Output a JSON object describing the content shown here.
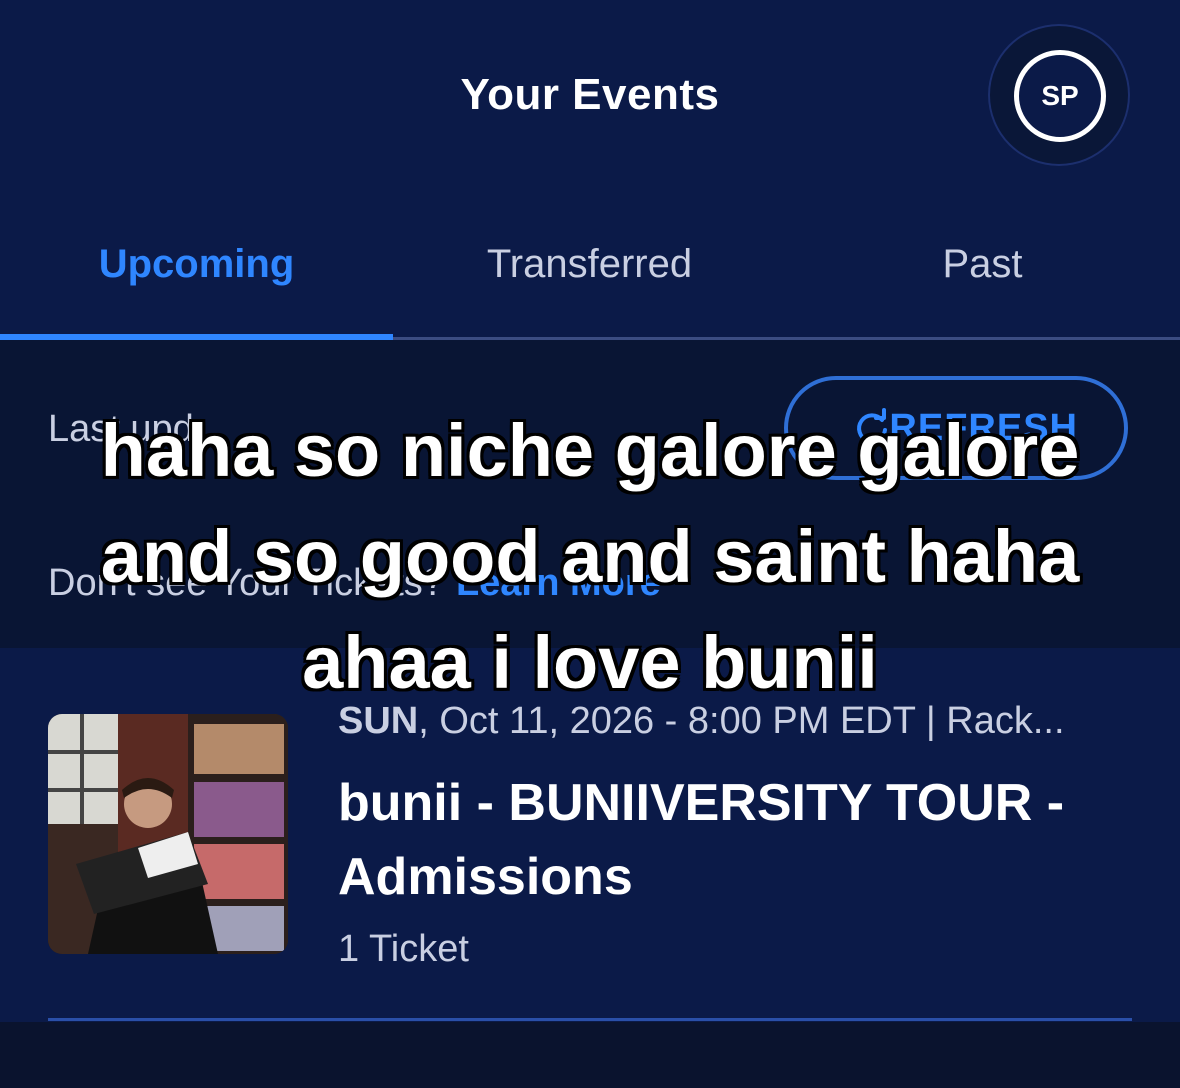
{
  "header": {
    "title": "Your Events",
    "avatar_initials": "SP"
  },
  "tabs": [
    {
      "label": "Upcoming",
      "active": true
    },
    {
      "label": "Transferred",
      "active": false
    },
    {
      "label": "Past",
      "active": false
    }
  ],
  "info": {
    "last_updated_label": "Last upd",
    "refresh_label": "REFRESH",
    "missing_tickets_text": "Don't see Your Tickets?",
    "learn_more_label": "Learn More"
  },
  "event": {
    "day": "SUN",
    "date_rest": ", Oct 11, 2026 - 8:00 PM EDT | Rack...",
    "title": "bunii - BUNIIVERSITY TOUR - Admissions",
    "ticket_count": "1 Ticket",
    "thumbnail_icon": "event-photo"
  },
  "overlay": {
    "caption": "haha so niche galore galore and so good and saint haha ahaa i love bunii"
  },
  "colors": {
    "background": "#0b1a48",
    "accent": "#2f86ff",
    "muted_text": "#c9cfe2"
  }
}
